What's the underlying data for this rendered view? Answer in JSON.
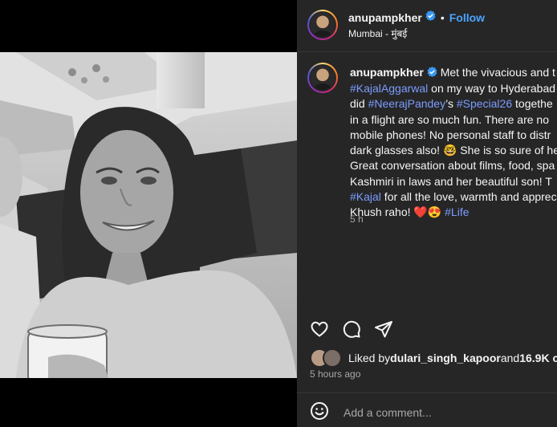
{
  "post": {
    "username": "anupampkher",
    "follow_label": "Follow",
    "separator": "•",
    "location": "Mumbai - मुंबई"
  },
  "caption": {
    "username": "anupampkher",
    "segments": [
      {
        "text": "Met the vivacious and t"
      },
      {
        "text": "#KajalAggarwal",
        "tag": true
      },
      {
        "text": " on my way to Hyderabad"
      },
      {
        "text": "did "
      },
      {
        "text": "#NeerajPandey",
        "tag": true
      },
      {
        "text": "’s "
      },
      {
        "text": "#Special26",
        "tag": true
      },
      {
        "text": " togethe"
      },
      {
        "text": "in a flight are so much fun. There are no"
      },
      {
        "text": "mobile phones! No personal staff to distr"
      },
      {
        "text": "dark glasses also! 🤓 She is so sure of he"
      },
      {
        "text": "Great conversation about films, food, spa"
      },
      {
        "text": "Kashmiri in laws and her beautiful son! T"
      },
      {
        "text": "#Kajal",
        "tag": true
      },
      {
        "text": " for all the love, warmth and apprec"
      },
      {
        "text": "Khush raho! ❤️😍 "
      },
      {
        "text": "#Life",
        "tag": true
      }
    ],
    "time": "5 h"
  },
  "likes": {
    "prefix": "Liked by ",
    "user": "dulari_singh_kapoor",
    "middle": " and ",
    "count": "16.9K c"
  },
  "time_ago": "5 hours ago",
  "comment": {
    "placeholder": "Add a comment..."
  },
  "colors": {
    "panel": "#262626",
    "link": "#4aa3ff",
    "hashtag": "#7c9cff",
    "verified": "#3897f0"
  },
  "icons": [
    "heart-icon",
    "comment-icon",
    "share-icon",
    "emoji-icon",
    "verified-badge-icon"
  ]
}
